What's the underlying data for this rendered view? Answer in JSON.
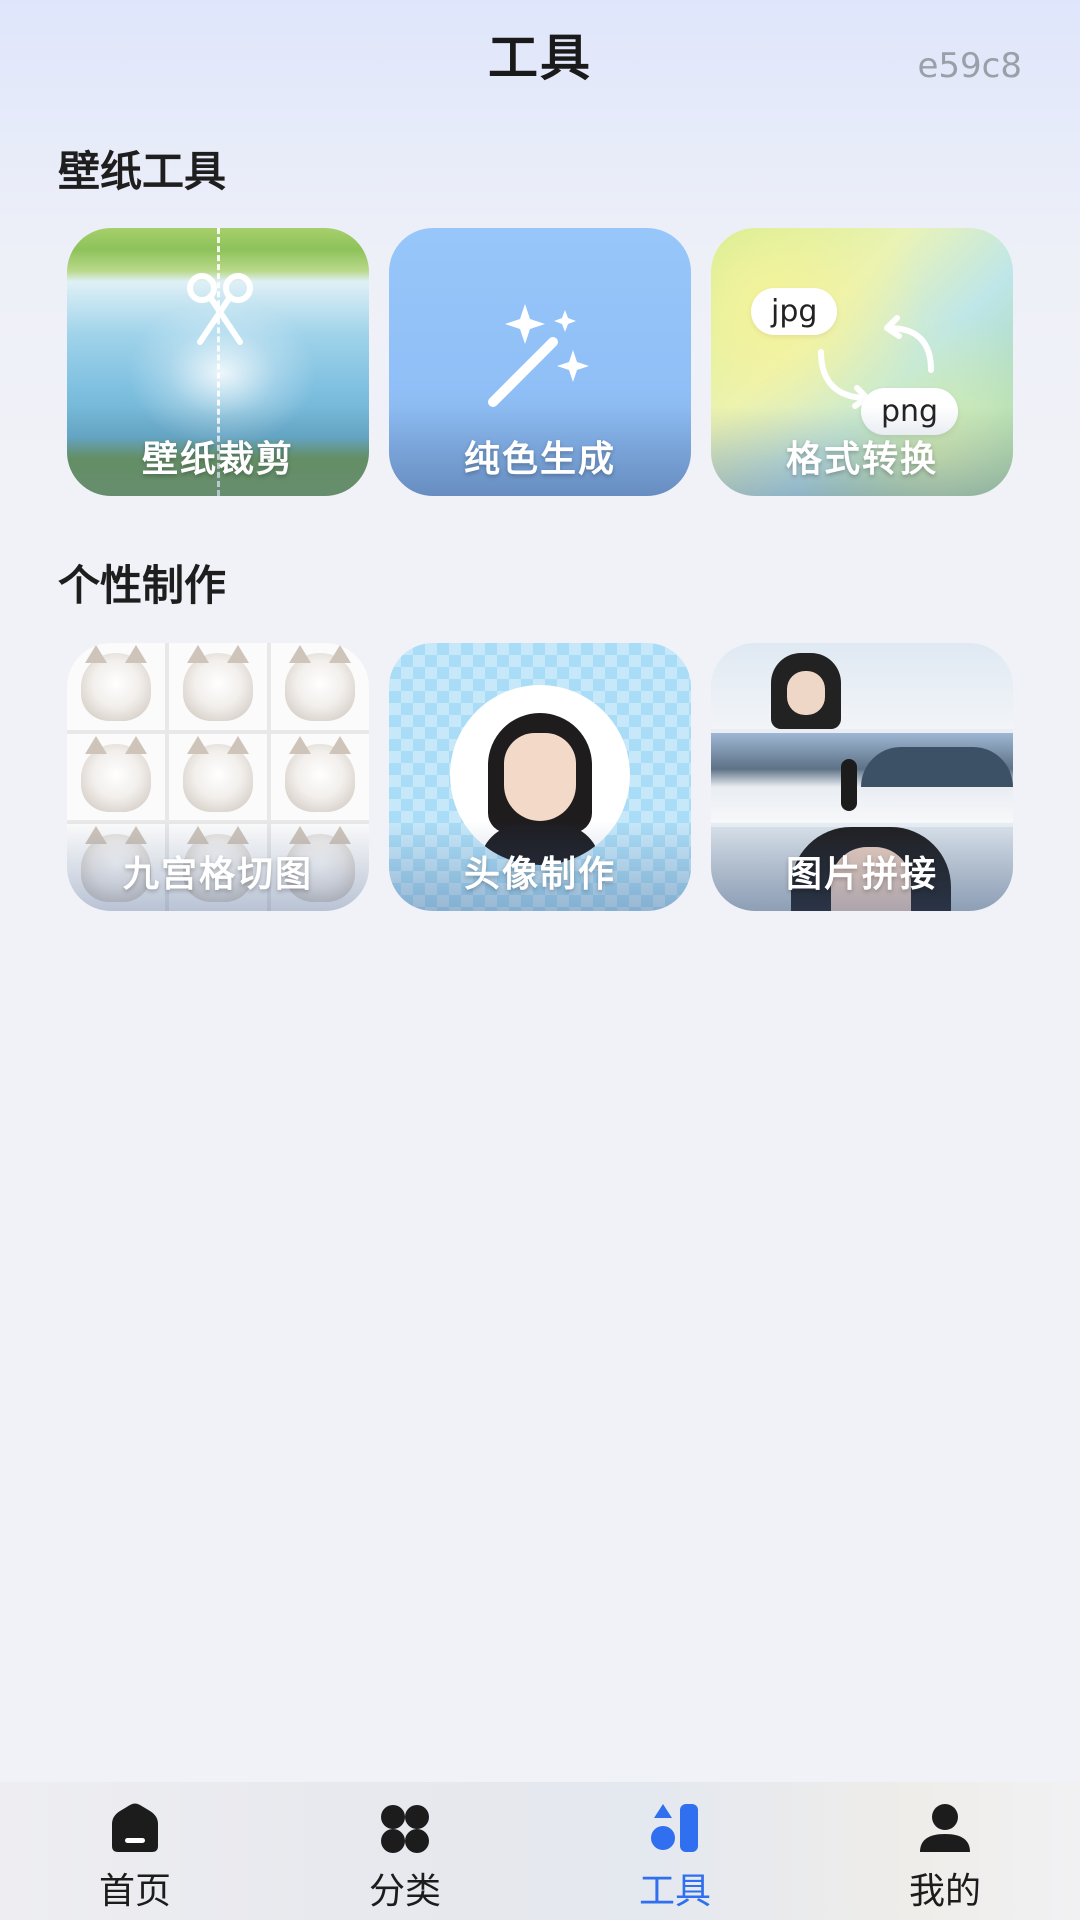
{
  "header": {
    "title": "工具",
    "version": "e59c8"
  },
  "sections": [
    {
      "title": "壁纸工具",
      "tools": [
        {
          "label": "壁纸裁剪",
          "icon": "scissors-icon"
        },
        {
          "label": "纯色生成",
          "icon": "magic-wand-icon"
        },
        {
          "label": "格式转换",
          "icon": "convert-arrows-icon",
          "from": "jpg",
          "to": "png"
        }
      ]
    },
    {
      "title": "个性制作",
      "tools": [
        {
          "label": "九宫格切图"
        },
        {
          "label": "头像制作"
        },
        {
          "label": "图片拼接"
        }
      ]
    }
  ],
  "bottom_nav": {
    "active_index": 2,
    "active_color": "#2f6ff0",
    "items": [
      {
        "label": "首页",
        "icon": "home-icon"
      },
      {
        "label": "分类",
        "icon": "category-icon"
      },
      {
        "label": "工具",
        "icon": "tools-icon"
      },
      {
        "label": "我的",
        "icon": "profile-icon"
      }
    ]
  }
}
